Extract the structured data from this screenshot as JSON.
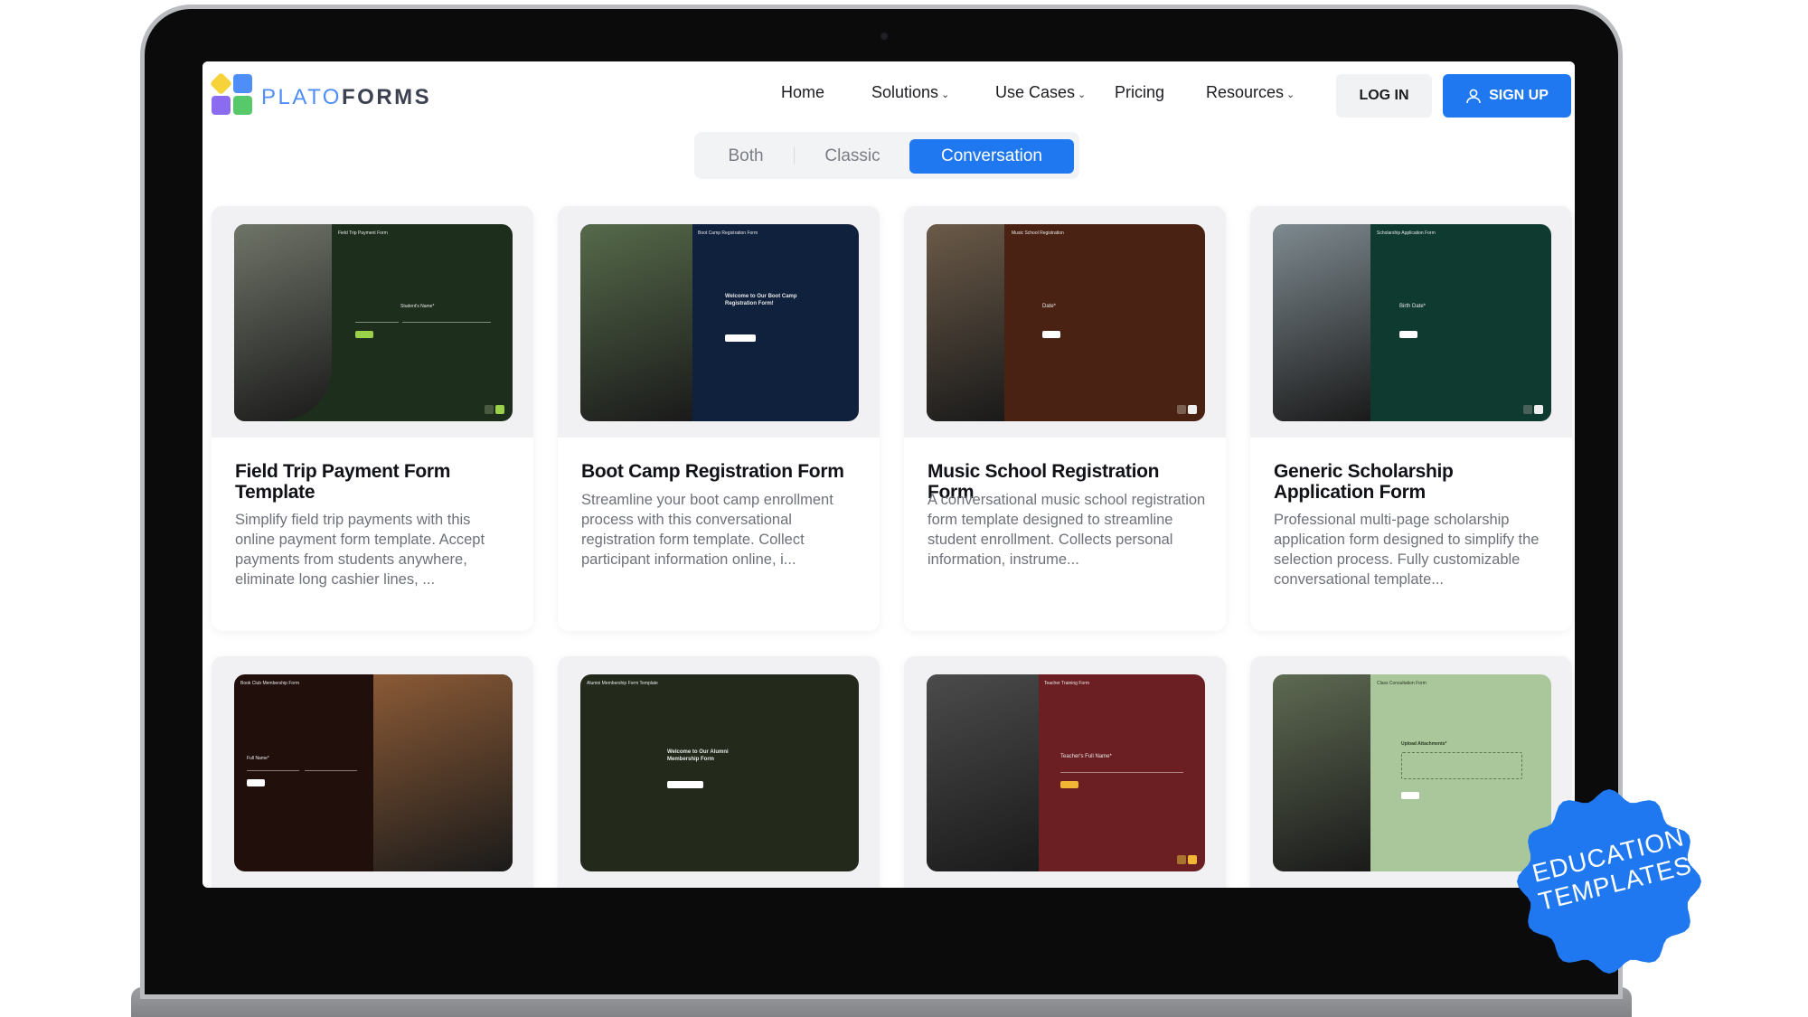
{
  "brand": {
    "part1": "PLATO",
    "part2": "FORMS"
  },
  "nav": {
    "items": [
      {
        "label": "Home",
        "dropdown": false
      },
      {
        "label": "Solutions",
        "dropdown": true
      },
      {
        "label": "Use Cases",
        "dropdown": true
      },
      {
        "label": "Pricing",
        "dropdown": false
      },
      {
        "label": "Resources",
        "dropdown": true
      }
    ],
    "login": "LOG IN",
    "signup": "SIGN UP"
  },
  "toggle": {
    "options": [
      "Both",
      "Classic",
      "Conversation"
    ],
    "selected": "Conversation"
  },
  "cards": [
    {
      "title": "Field Trip Payment Form Template",
      "desc": "Simplify field trip payments with this online payment form template. Accept payments from students anywhere, eliminate long cashier lines, ...",
      "thumb_title": "Field Trip Payment Form",
      "thumb_label": "Student's Name*",
      "panel_color": "#1d2e1c",
      "photo_color": "#6f7468"
    },
    {
      "title": "Boot Camp Registration Form",
      "desc": "Streamline your boot camp enrollment process with this conversational registration form template. Collect participant information online, i...",
      "thumb_title": "Boot Camp Registration Form",
      "thumb_label": "Welcome to Our Boot Camp Registration Form!",
      "panel_color": "#10213d",
      "photo_color": "#566a4a"
    },
    {
      "title": "Music School Registration Form",
      "desc": "A conversational music school registration form template designed to streamline student enrollment. Collects personal information, instrume...",
      "thumb_title": "Music School Registration",
      "thumb_label": "Date*",
      "panel_color": "#4a2214",
      "photo_color": "#6b5a48"
    },
    {
      "title": "Generic Scholarship Application Form",
      "desc": "Professional multi-page scholarship application form designed to simplify the selection process. Fully customizable conversational template...",
      "thumb_title": "Scholarship Application Form",
      "thumb_label": "Birth Date*",
      "panel_color": "#0f3a30",
      "photo_color": "#7e8a90"
    },
    {
      "title": "",
      "desc": "",
      "thumb_title": "Book Club Membership Form",
      "thumb_label": "Full Name*",
      "panel_color": "#200f0a",
      "photo_color": "#8b5a36"
    },
    {
      "title": "",
      "desc": "",
      "thumb_title": "Alumni Membership Form Template",
      "thumb_label": "Welcome to Our Alumni Membership Form",
      "panel_color": "#232a1c",
      "photo_color": "#2c3324"
    },
    {
      "title": "",
      "desc": "",
      "thumb_title": "Teacher Training Form",
      "thumb_label": "Teacher's Full Name*",
      "panel_color": "#6c1f22",
      "photo_color": "#4b4b4b"
    },
    {
      "title": "",
      "desc": "",
      "thumb_title": "Class Consultation Form",
      "thumb_label": "Upload Attachments*",
      "panel_color": "#a9c79a",
      "photo_color": "#5e6a52"
    }
  ],
  "badge": {
    "text": "EDUCATION TEMPLATES",
    "color": "#1f78f0"
  },
  "colors": {
    "accent": "#1f78f0"
  }
}
